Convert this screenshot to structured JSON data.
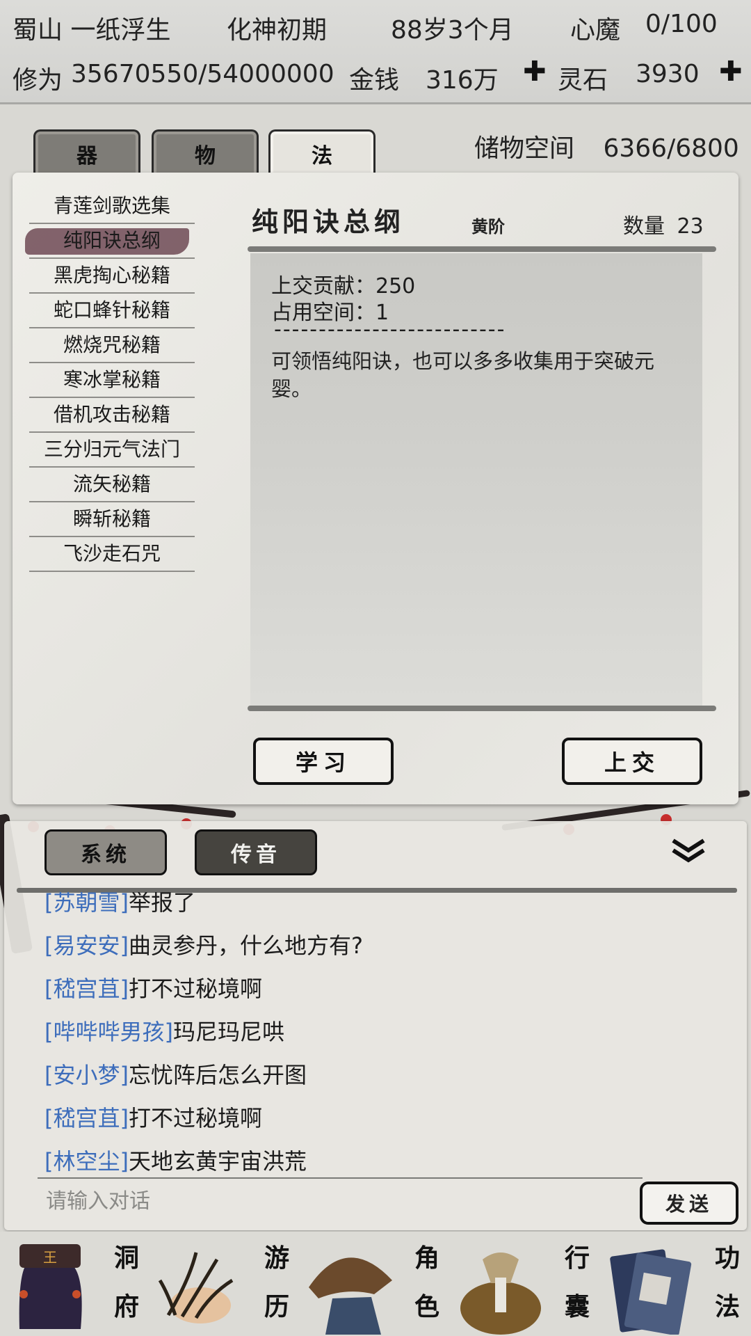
{
  "header": {
    "location_name": "蜀山 一纸浮生",
    "realm": "化神初期",
    "age": "88岁3个月",
    "heart_demon_label": "心魔",
    "heart_demon_value": "0/100",
    "cultivation_label": "修为",
    "cultivation_value": "35670550/54000000",
    "money_label": "金钱",
    "money_value": "316万",
    "spirit_stone_label": "灵石",
    "spirit_stone_value": "3930",
    "plus_icon": "cross-icon"
  },
  "tabs": [
    {
      "label": "器",
      "active": false
    },
    {
      "label": "物",
      "active": false
    },
    {
      "label": "法",
      "active": true
    }
  ],
  "storage": {
    "label": "储物空间",
    "value": "6366/6800"
  },
  "items": [
    "青莲剑歌选集",
    "纯阳诀总纲",
    "黑虎掏心秘籍",
    "蛇口蜂针秘籍",
    "燃烧咒秘籍",
    "寒冰掌秘籍",
    "借机攻击秘籍",
    "三分归元气法门",
    "流矢秘籍",
    "瞬斩秘籍",
    "飞沙走石咒"
  ],
  "selected_index": 1,
  "detail": {
    "title": "纯阳诀总纲",
    "grade": "黄阶",
    "quantity_label": "数量",
    "quantity_value": "23",
    "contribution": "上交贡献：250",
    "space": "占用空间：1",
    "separator": "--------------------------",
    "description": "可领悟纯阳诀，也可以多多收集用于突破元婴。",
    "learn_button": "学习",
    "submit_button": "上交"
  },
  "chat": {
    "tab_system": "系统",
    "tab_message": "传音",
    "collapse_icon": "double-chevron-down-icon",
    "messages": [
      {
        "name": "[苏朝雪]",
        "text": "举报了"
      },
      {
        "name": "[易安安]",
        "text": "曲灵参丹，什么地方有?"
      },
      {
        "name": "[嵇宫苴]",
        "text": "打不过秘境啊"
      },
      {
        "name": "[哔哔哔男孩]",
        "text": "玛尼玛尼哄"
      },
      {
        "name": "[安小梦]",
        "text": "忘忧阵后怎么开图"
      },
      {
        "name": "[嵇宫苴]",
        "text": "打不过秘境啊"
      },
      {
        "name": "[林空尘]",
        "text": "天地玄黄宇宙洪荒"
      }
    ],
    "input_placeholder": "请输入对话",
    "send_button": "发送"
  },
  "nav": [
    {
      "label_top": "洞",
      "label_bottom": "府",
      "icon": "cave-mansion-icon"
    },
    {
      "label_top": "游",
      "label_bottom": "历",
      "icon": "travel-grass-icon"
    },
    {
      "label_top": "角",
      "label_bottom": "色",
      "icon": "character-hat-icon"
    },
    {
      "label_top": "行",
      "label_bottom": "囊",
      "icon": "bag-icon"
    },
    {
      "label_top": "功",
      "label_bottom": "法",
      "icon": "scripture-books-icon"
    }
  ],
  "colors": {
    "player_name": "#3d6dbb",
    "selected_item_brush": "#6f4a55",
    "accent_dark": "#111111"
  }
}
